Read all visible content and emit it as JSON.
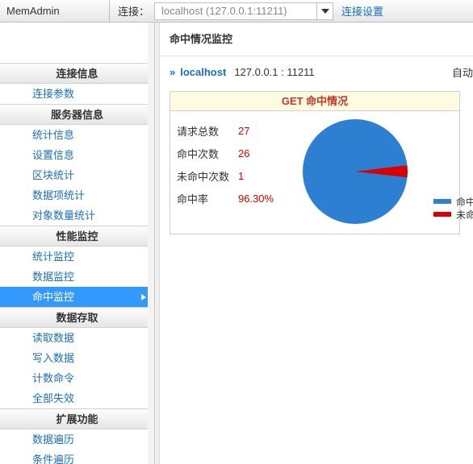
{
  "app_title": "MemAdmin",
  "topbar": {
    "connect_label": "连接：",
    "connect_value": "localhost (127.0.0.1:11211)",
    "settings_label": "连接设置"
  },
  "sidebar": {
    "groups": [
      {
        "title": "连接信息",
        "items": [
          {
            "label": "连接参数",
            "active": false
          }
        ]
      },
      {
        "title": "服务器信息",
        "items": [
          {
            "label": "统计信息",
            "active": false
          },
          {
            "label": "设置信息",
            "active": false
          },
          {
            "label": "区块统计",
            "active": false
          },
          {
            "label": "数据项统计",
            "active": false
          },
          {
            "label": "对象数量统计",
            "active": false
          }
        ]
      },
      {
        "title": "性能监控",
        "items": [
          {
            "label": "统计监控",
            "active": false
          },
          {
            "label": "数据监控",
            "active": false
          },
          {
            "label": "命中监控",
            "active": true
          }
        ]
      },
      {
        "title": "数据存取",
        "items": [
          {
            "label": "读取数据",
            "active": false
          },
          {
            "label": "写入数据",
            "active": false
          },
          {
            "label": "计数命令",
            "active": false
          },
          {
            "label": "全部失效",
            "active": false
          }
        ]
      },
      {
        "title": "扩展功能",
        "items": [
          {
            "label": "数据遍历",
            "active": false
          },
          {
            "label": "条件遍历",
            "active": false
          }
        ]
      }
    ]
  },
  "main": {
    "title": "命中情况监控",
    "crumb_host": "localhost",
    "crumb_ip": "127.0.0.1 : 11211",
    "auto_label": "自动",
    "panel_title": "GET 命中情况",
    "stats": {
      "req_label": "请求总数",
      "req_value": "27",
      "hit_label": "命中次数",
      "hit_value": "26",
      "miss_label": "未命中次数",
      "miss_value": "1",
      "rate_label": "命中率",
      "rate_value": "96.30%"
    },
    "legend": {
      "hit": "命中",
      "miss": "未命中"
    }
  },
  "colors": {
    "blue": "#2d7fd1",
    "red": "#d80000",
    "link": "#1a6fbd"
  },
  "chart_data": {
    "type": "pie",
    "title": "GET 命中情况",
    "series": [
      {
        "name": "命中",
        "value": 26,
        "color": "#2d7fd1"
      },
      {
        "name": "未命中",
        "value": 1,
        "color": "#d80000"
      }
    ]
  }
}
